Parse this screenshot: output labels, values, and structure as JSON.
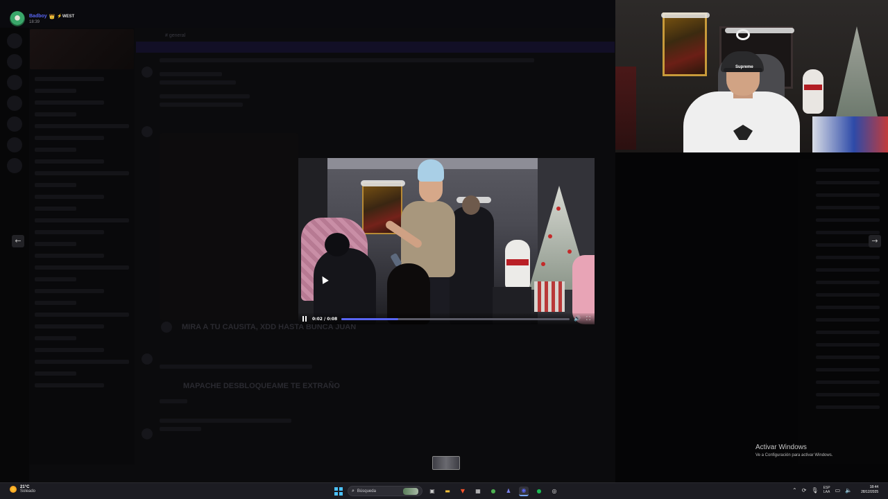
{
  "user": {
    "name": "Badboy",
    "crown": "👑",
    "tag": "⚡WEST",
    "time": "18:39"
  },
  "background": {
    "headline_1": "MIRA A TU CAUSITA, XDD HASTA BUNCA JUAN",
    "headline_2": "MAPACHE DESBLOQUEAME TE EXTRAÑO",
    "channel_header": "# general"
  },
  "webcam": {
    "cap_text": "Supreme"
  },
  "viewer": {
    "prev_icon": "arrow-left-icon",
    "next_icon": "arrow-right-icon"
  },
  "video": {
    "time_display": "0:02 / 0:08",
    "progress": 0.25,
    "pause_icon": "pause-icon",
    "volume_icon": "volume-icon",
    "fullscreen_icon": "fullscreen-icon",
    "accent_color": "#5865f2"
  },
  "watermark": {
    "title": "Activar Windows",
    "subtitle": "Ve a Configuración para activar Windows."
  },
  "taskbar": {
    "weather_temp": "21°C",
    "weather_cond": "Soleado",
    "search_placeholder": "Búsqueda",
    "apps": [
      {
        "name": "task-view-icon",
        "glyph": "▣",
        "color": "#cccccc"
      },
      {
        "name": "file-explorer-icon",
        "glyph": "▬",
        "color": "#f3c13a"
      },
      {
        "name": "brave-browser-icon",
        "glyph": "▼",
        "color": "#fb542b"
      },
      {
        "name": "app-grid-icon",
        "glyph": "▦",
        "color": "#e0e0e0"
      },
      {
        "name": "chrome-icon",
        "glyph": "●",
        "color": "#4caf50"
      },
      {
        "name": "teams-icon",
        "glyph": "♟",
        "color": "#7b83eb"
      },
      {
        "name": "discord-icon",
        "glyph": "◉",
        "color": "#5865f2"
      },
      {
        "name": "spotify-icon",
        "glyph": "●",
        "color": "#1db954"
      },
      {
        "name": "record-icon",
        "glyph": "◎",
        "color": "#e0e0e0"
      }
    ],
    "lang_line1": "ESP",
    "lang_line2": "LAA",
    "clock_time": "18:44",
    "clock_date": "28/12/2025"
  }
}
